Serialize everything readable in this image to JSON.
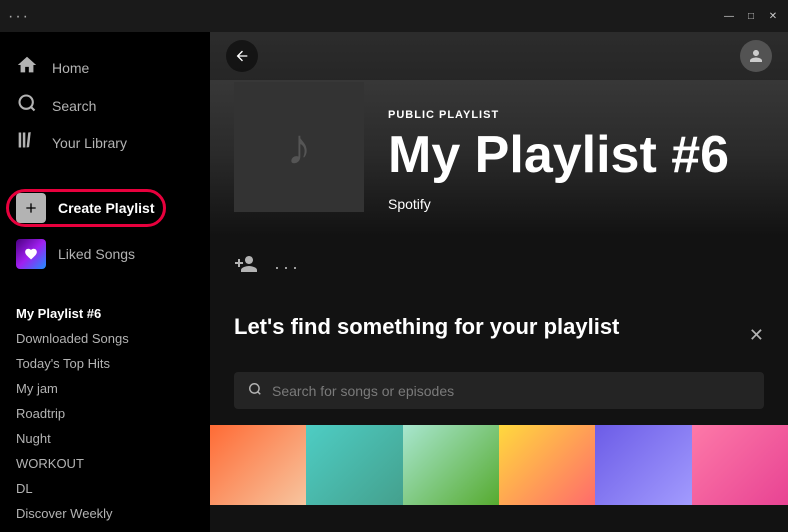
{
  "titlebar": {
    "dots": "···",
    "minimize": "—",
    "maximize": "□",
    "close": "✕"
  },
  "sidebar": {
    "dots": "···",
    "nav": [
      {
        "label": "Home",
        "icon": "⌂"
      },
      {
        "label": "Search",
        "icon": "○"
      },
      {
        "label": "Your Library",
        "icon": "|||"
      }
    ],
    "create_playlist": "Create Playlist",
    "liked_songs": "Liked Songs",
    "playlists": [
      {
        "label": "My Playlist #6",
        "active": true
      },
      {
        "label": "Downloaded Songs"
      },
      {
        "label": "Today's Top Hits"
      },
      {
        "label": "My jam"
      },
      {
        "label": "Roadtrip"
      },
      {
        "label": "Nught"
      },
      {
        "label": "WORKOUT"
      },
      {
        "label": "DL"
      },
      {
        "label": "Discover Weekly"
      }
    ]
  },
  "main": {
    "playlist_type": "PUBLIC PLAYLIST",
    "playlist_title": "My Playlist #6",
    "playlist_owner": "Spotify",
    "find_songs_title": "Let's find something for your playlist",
    "search_placeholder": "Search for songs or episodes"
  },
  "colors": {
    "accent_red": "#e8003d",
    "sidebar_bg": "#000000",
    "main_bg": "#121212",
    "title_bar_bg": "#1a1a1a"
  }
}
